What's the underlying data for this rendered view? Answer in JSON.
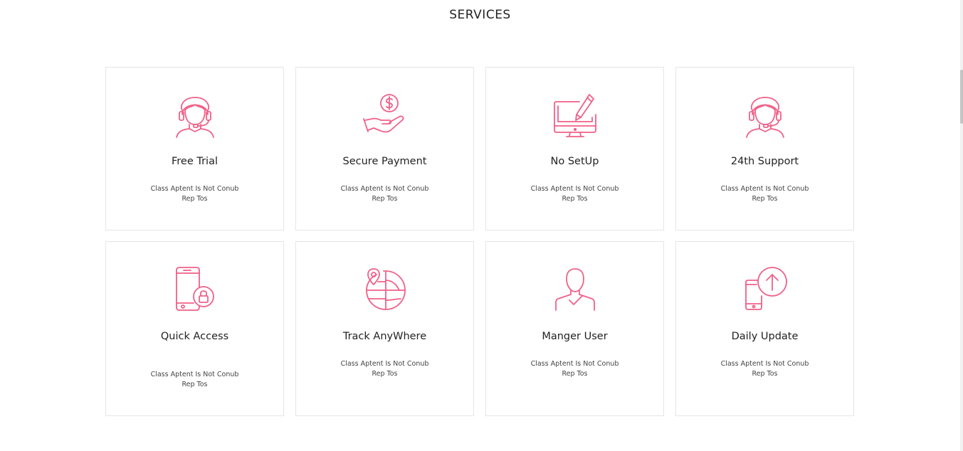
{
  "section": {
    "title": "SERVICES"
  },
  "accent_color": "#f06088",
  "cards": [
    {
      "icon": "headset-support-icon",
      "title": "Free Trial",
      "desc_line1": "Class Aptent Is Not Conub",
      "desc_line2": "Rep Tos"
    },
    {
      "icon": "payment-hand-icon",
      "title": "Secure Payment",
      "desc_line1": "Class Aptent Is Not Conub",
      "desc_line2": "Rep Tos"
    },
    {
      "icon": "monitor-pencil-icon",
      "title": "No SetUp",
      "desc_line1": "Class Aptent Is Not Conub",
      "desc_line2": "Rep Tos"
    },
    {
      "icon": "headset-support-icon",
      "title": "24th Support",
      "desc_line1": "Class Aptent Is Not Conub",
      "desc_line2": "Rep Tos"
    },
    {
      "icon": "phone-lock-icon",
      "title": "Quick Access",
      "desc_line1": "Class Aptent Is Not Conub",
      "desc_line2": "Rep Tos"
    },
    {
      "icon": "globe-pin-icon",
      "title": "Track AnyWhere",
      "desc_line1": "Class Aptent Is Not Conub",
      "desc_line2": "Rep Tos"
    },
    {
      "icon": "user-check-icon",
      "title": "Manger User",
      "desc_line1": "Class Aptent Is Not Conub",
      "desc_line2": "Rep Tos"
    },
    {
      "icon": "phone-upload-icon",
      "title": "Daily Update",
      "desc_line1": "Class Aptent Is Not Conub",
      "desc_line2": "Rep Tos"
    }
  ]
}
